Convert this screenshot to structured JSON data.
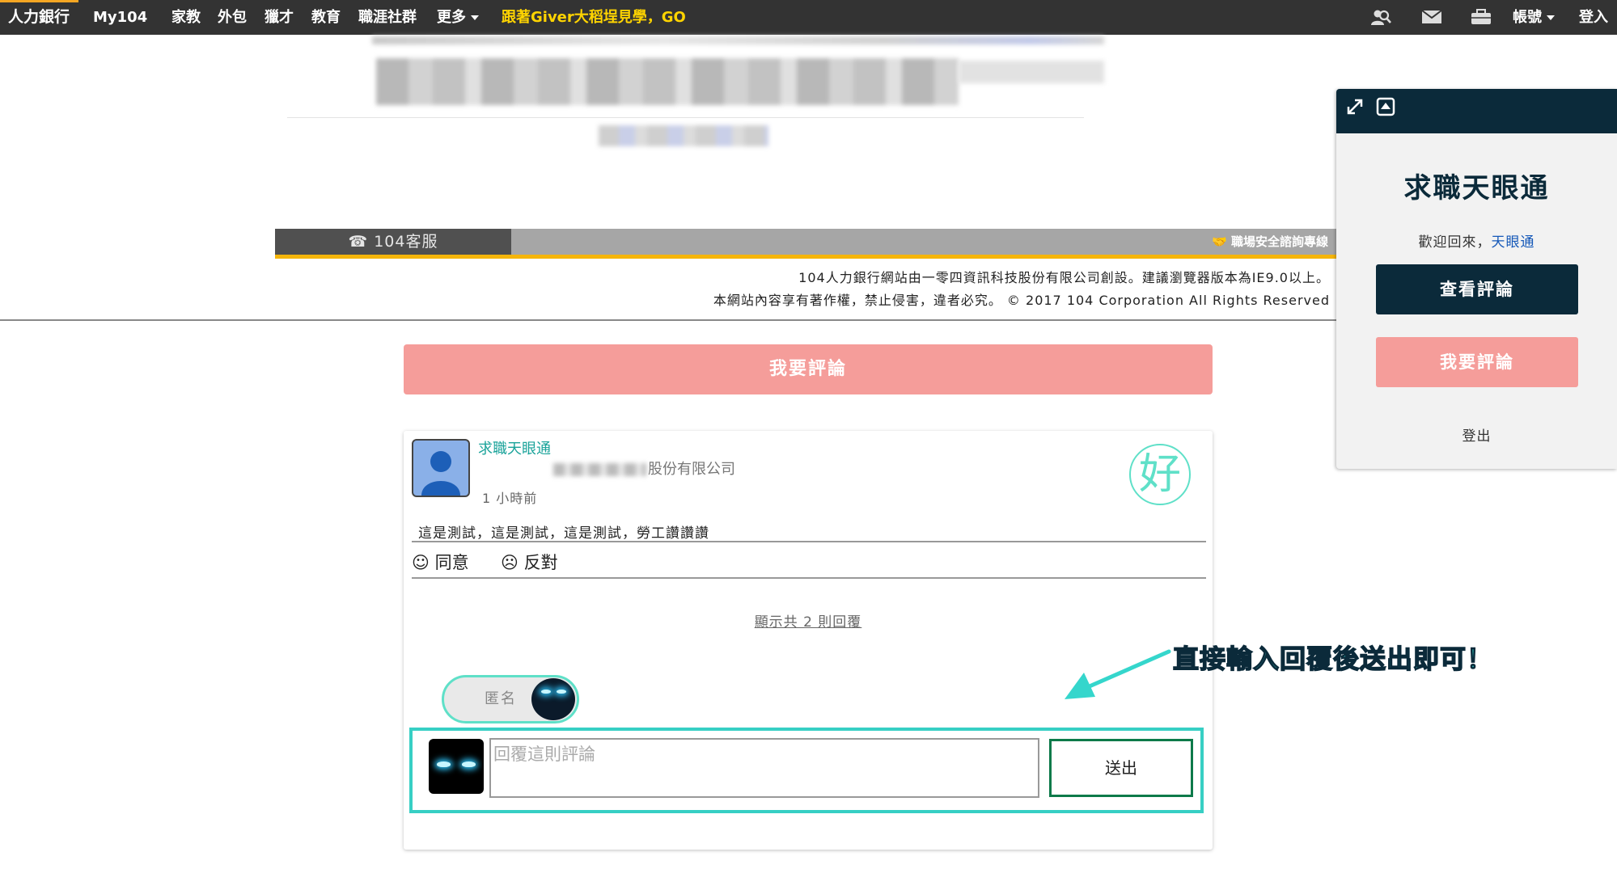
{
  "colors": {
    "topbar": "#333333",
    "promo": "#ffd400",
    "navy": "#0b2a3a",
    "pink": "#f59d9a",
    "teal": "#37cfc4",
    "footer_yellow": "#f5b50a"
  },
  "nav": {
    "brand": "人力銀行",
    "items": [
      "My104",
      "家教",
      "外包",
      "獵才",
      "教育",
      "職涯社群"
    ],
    "more": "更多",
    "promo": "跟著Giver大稻埕見學，GO",
    "account": "帳號",
    "login": "登入",
    "icons": [
      "person-search-icon",
      "mail-icon",
      "briefcase-icon"
    ]
  },
  "footer": {
    "service": "☎ 104客服",
    "safety": "職場安全諮詢專線",
    "line1": "104人力銀行網站由一零四資訊科技股份有限公司創設。建議瀏覽器版本為IE9.0以上。",
    "line2": "本網站內容享有著作權，禁止侵害，違者必究。 © 2017 104 Corporation All Rights Reserved"
  },
  "main": {
    "comment_button": "我要評論"
  },
  "review": {
    "username": "求職天眼通",
    "company_suffix": "股份有限公司",
    "time": "1 小時前",
    "badge": "好",
    "content": "這是測試，這是測試，這是測試，勞工讚讚讚",
    "agree": "☺ 同意",
    "disagree": "☹ 反對",
    "show_replies": "顯示共 2 則回覆",
    "anonymous_label": "匿名",
    "reply_placeholder": "回覆這則評論",
    "send": "送出"
  },
  "annotation": "直接輸入回覆後送出即可！",
  "panel": {
    "title": "求職天眼通",
    "welcome": "歡迎回來，",
    "welcome_name": "天眼通",
    "view_button": "查看評論",
    "comment_button": "我要評論",
    "logout": "登出",
    "icons": [
      "expand-icon",
      "collapse-icon"
    ]
  }
}
